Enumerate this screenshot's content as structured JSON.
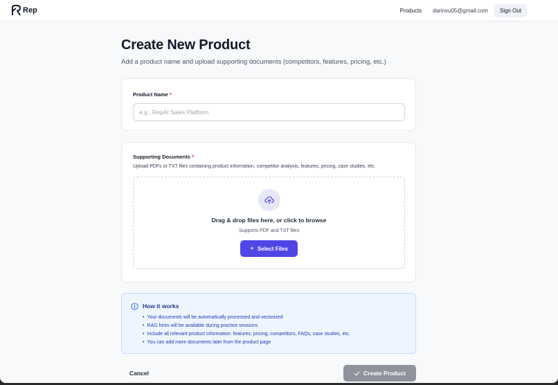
{
  "header": {
    "logo_text": "Rep",
    "nav_products": "Products",
    "user_email": "darinvu05@gmail.com",
    "sign_out": "Sign Out"
  },
  "page": {
    "title": "Create New Product",
    "subtitle": "Add a product name and upload supporting documents (competitors, features, pricing, etc.)"
  },
  "product_name": {
    "label": "Product Name",
    "required_mark": "*",
    "placeholder": "e.g., RepAI Sales Platform",
    "value": ""
  },
  "documents": {
    "label": "Supporting Documents",
    "required_mark": "*",
    "helper": "Upload PDFs or TXT files containing product information, competitor analysis, features, pricing, case studies, etc.",
    "drop_title": "Drag & drop files here, or click to browse",
    "drop_sub": "Supports PDF and TXT files",
    "select_button": "Select Files",
    "select_icon": "plus-icon",
    "upload_icon": "upload-cloud-icon"
  },
  "info": {
    "icon": "info-icon",
    "title": "How it works",
    "items": [
      "Your documents will be automatically processed and vectorized",
      "RAG hints will be available during practice sessions",
      "Include all relevant product information: features, pricing, competitors, FAQs, case studies, etc.",
      "You can add more documents later from the product page"
    ]
  },
  "actions": {
    "cancel": "Cancel",
    "create": "Create Product",
    "create_icon": "check-icon"
  },
  "colors": {
    "accent": "#4f46e5",
    "disabled_button": "#8e939c",
    "info_bg": "#eef5fe",
    "required": "#dc2626"
  }
}
